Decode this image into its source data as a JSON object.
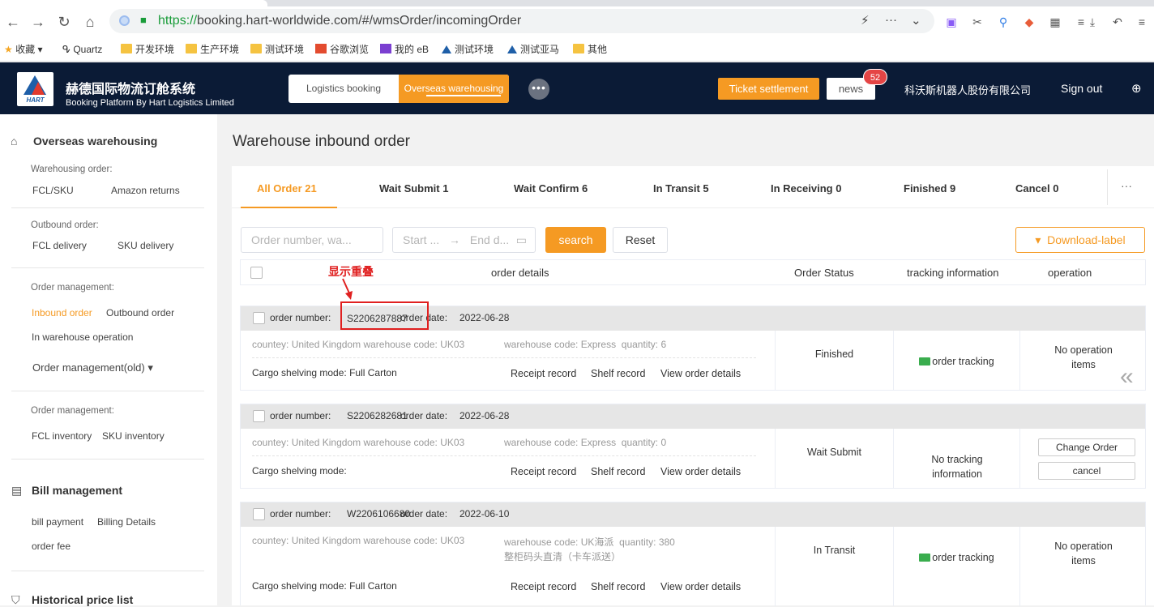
{
  "browser": {
    "url_protocol": "https://",
    "url_rest": "booking.hart-worldwide.com/#/wmsOrder/incomingOrder",
    "bookmarks": [
      {
        "label": "收藏",
        "type": "star"
      },
      {
        "label": "Quartz",
        "type": "link"
      },
      {
        "label": "开发环境",
        "type": "folder"
      },
      {
        "label": "生产环境",
        "type": "folder"
      },
      {
        "label": "测试环境",
        "type": "folder"
      },
      {
        "label": "谷歌浏览",
        "type": "app"
      },
      {
        "label": "我的 eB",
        "type": "app"
      },
      {
        "label": "测试环境",
        "type": "site"
      },
      {
        "label": "测试亚马",
        "type": "site"
      },
      {
        "label": "其他",
        "type": "folder"
      }
    ]
  },
  "header": {
    "logo_text": "HART",
    "brand_cn": "赫德国际物流订舱系统",
    "brand_en": "Booking Platform By Hart Logistics Limited",
    "seg_logistics": "Logistics booking",
    "seg_overseas": "Overseas warehousing",
    "ticket": "Ticket settlement",
    "news": "news",
    "news_count": "52",
    "company": "科沃斯机器人股份有限公司",
    "signout": "Sign out"
  },
  "sidebar": {
    "overseas": "Overseas warehousing",
    "warehousing_order": "Warehousing order:",
    "fcl_sku": "FCL/SKU",
    "amazon_returns": "Amazon returns",
    "outbound_order_label": "Outbound order:",
    "fcl_delivery": "FCL delivery",
    "sku_delivery": "SKU delivery",
    "order_mgmt": "Order management:",
    "inbound_order": "Inbound order",
    "outbound_order": "Outbound order",
    "in_warehouse": "In warehouse operation",
    "order_mgmt_old": "Order management(old)",
    "order_mgmt2": "Order management:",
    "fcl_inventory": "FCL inventory",
    "sku_inventory": "SKU inventory",
    "bill_mgmt": "Bill management",
    "bill_payment": "bill payment",
    "billing_details": "Billing Details",
    "order_fee": "order fee",
    "hist_price": "Historical price list"
  },
  "main": {
    "title": "Warehouse inbound order",
    "tabs": [
      {
        "label": "All Order 21"
      },
      {
        "label": "Wait Submit 1"
      },
      {
        "label": "Wait Confirm 6"
      },
      {
        "label": "In Transit 5"
      },
      {
        "label": "In Receiving 0"
      },
      {
        "label": "Finished 9"
      },
      {
        "label": "Cancel 0"
      }
    ],
    "tab_more": "···",
    "search_placeholder": "Order number, wa...",
    "start_placeholder": "Start ...",
    "end_placeholder": "End d...",
    "search_btn": "search",
    "reset_btn": "Reset",
    "download_btn": "Download-label",
    "col_details": "order details",
    "col_status": "Order Status",
    "col_tracking": "tracking information",
    "col_operation": "operation",
    "annotation": "显示重叠"
  },
  "orders": [
    {
      "number_label": "order number:",
      "number": "S2206287887",
      "date_label": "order date:",
      "date": "2022-06-28",
      "country_label": "countey:",
      "country": "United Kingdom",
      "wh_label": "warehouse code:",
      "wh": "UK03",
      "wh2_label": "warehouse code:",
      "wh2": "Express",
      "qty_label": "quantity:",
      "qty": "6",
      "shelf_label": "Cargo shelving mode:",
      "shelf": "Full Carton",
      "receipt": "Receipt record",
      "shelf_record": "Shelf record",
      "view": "View order details",
      "status": "Finished",
      "tracking": "order tracking",
      "operation": "No operation items"
    },
    {
      "number_label": "order number:",
      "number": "S2206282681",
      "date_label": "order date:",
      "date": "2022-06-28",
      "country_label": "countey:",
      "country": "United Kingdom",
      "wh_label": "warehouse code:",
      "wh": "UK03",
      "wh2_label": "warehouse code:",
      "wh2": "Express",
      "qty_label": "quantity:",
      "qty": "0",
      "shelf_label": "Cargo shelving mode:",
      "shelf": "",
      "receipt": "Receipt record",
      "shelf_record": "Shelf record",
      "view": "View order details",
      "status": "Wait Submit",
      "tracking": "No tracking information",
      "change": "Change Order",
      "cancel": "cancel"
    },
    {
      "number_label": "order number:",
      "number": "W2206106680",
      "date_label": "order date:",
      "date": "2022-06-10",
      "country_label": "countey:",
      "country": "United Kingdom",
      "wh_label": "warehouse code:",
      "wh": "UK03",
      "wh2_label": "warehouse code:",
      "wh2": "UK海派",
      "qty_label": "quantity:",
      "qty": "380",
      "wh2_extra": "整柜码头直清（卡车派送）",
      "shelf_label": "Cargo shelving mode:",
      "shelf": "Full Carton",
      "receipt": "Receipt record",
      "shelf_record": "Shelf record",
      "view": "View order details",
      "status": "In Transit",
      "tracking": "order tracking",
      "operation": "No operation items"
    }
  ]
}
